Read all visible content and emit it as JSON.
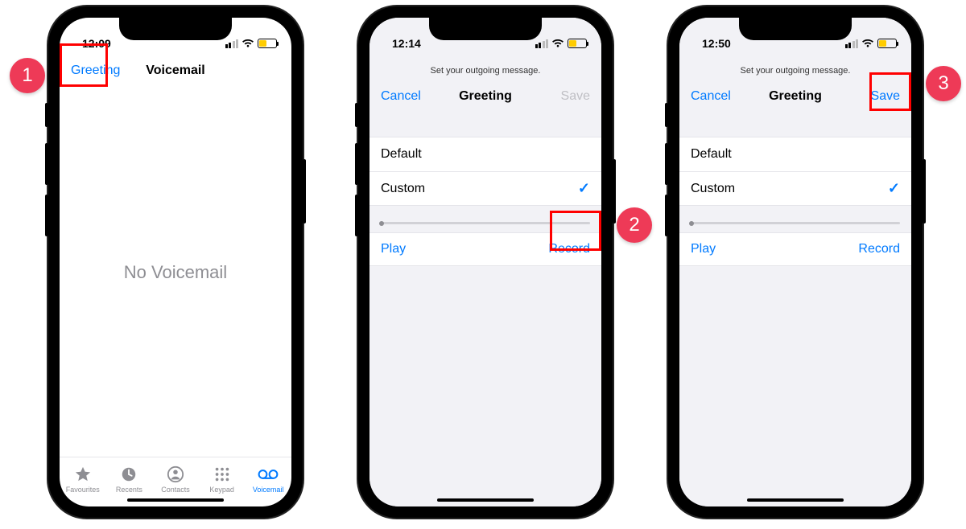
{
  "steps": {
    "s1": "1",
    "s2": "2",
    "s3": "3"
  },
  "phone1": {
    "time": "12:09",
    "nav_left": "Greeting",
    "nav_title": "Voicemail",
    "body_msg": "No Voicemail",
    "tabs": {
      "favourites": "Favourites",
      "recents": "Recents",
      "contacts": "Contacts",
      "keypad": "Keypad",
      "voicemail": "Voicemail"
    }
  },
  "phone2": {
    "time": "12:14",
    "hint": "Set your outgoing message.",
    "cancel": "Cancel",
    "title": "Greeting",
    "save": "Save",
    "row_default": "Default",
    "row_custom": "Custom",
    "play": "Play",
    "record": "Record"
  },
  "phone3": {
    "time": "12:50",
    "hint": "Set your outgoing message.",
    "cancel": "Cancel",
    "title": "Greeting",
    "save": "Save",
    "row_default": "Default",
    "row_custom": "Custom",
    "play": "Play",
    "record": "Record"
  }
}
